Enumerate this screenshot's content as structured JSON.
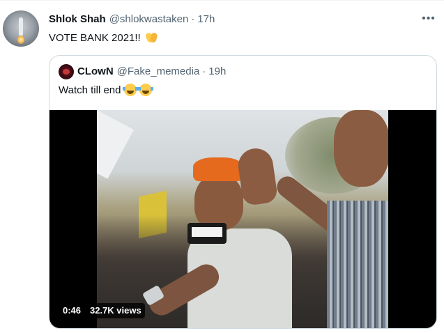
{
  "tweet": {
    "author_name": "Shlok Shah",
    "author_handle": "@shlokwastaken",
    "separator": "·",
    "time": "17h",
    "text": "VOTE BANK 2021!!",
    "text_emoji": "clapping-hands-emoji",
    "more_label": "•••"
  },
  "quoted_tweet": {
    "author_name": "CLowN",
    "author_handle": "@Fake_memedia",
    "separator": "·",
    "time": "19h",
    "text": "Watch till end",
    "text_emoji": [
      "face-with-tears-of-joy-emoji",
      "face-with-tears-of-joy-emoji"
    ],
    "video": {
      "duration": "0:46",
      "views": "32.7K views"
    }
  },
  "colors": {
    "text_primary": "#0f1419",
    "text_secondary": "#536471",
    "border": "#cfd9de",
    "video_background": "#000000"
  }
}
